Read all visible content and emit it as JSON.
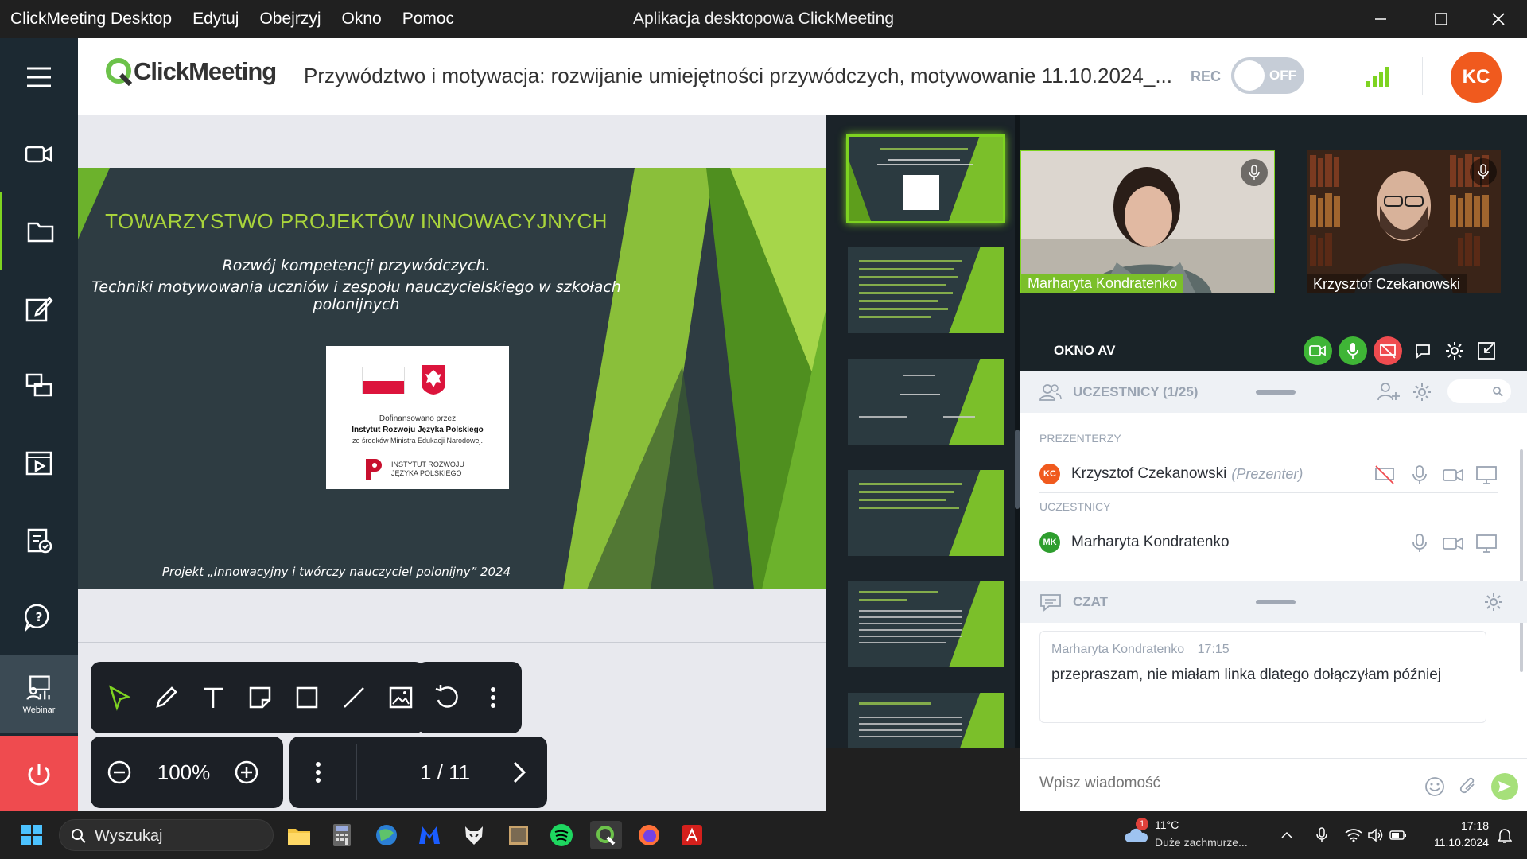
{
  "window": {
    "menu": [
      "ClickMeeting Desktop",
      "Edytuj",
      "Obejrzyj",
      "Okno",
      "Pomoc"
    ],
    "title": "Aplikacja desktopowa ClickMeeting"
  },
  "header": {
    "logo": "ClickMeeting",
    "meeting_title": "Przywództwo i motywacja: rozwijanie umiejętności przywódczych, motywowanie 11.10.2024_...",
    "rec_label": "REC",
    "rec_state": "OFF",
    "user_initials": "KC"
  },
  "sidebar": {
    "items": [
      "menu",
      "video",
      "files",
      "edit",
      "screen-share",
      "media",
      "survey",
      "qa",
      "webinar"
    ],
    "webinar_label": "Webinar"
  },
  "slide": {
    "title": "TOWARZYSTWO PROJEKTÓW INNOWACYJNYCH",
    "subtitle_1": "Rozwój kompetencji przywódczych.",
    "subtitle_2": "Techniki motywowania uczniów i zespołu nauczycielskiego w szkołach polonijnych",
    "card_line_1": "Dofinansowano przez",
    "card_line_2": "Instytut Rozwoju Języka Polskiego",
    "card_line_3": "ze środków Ministra Edukacji Narodowej.",
    "card_logo_1": "INSTYTUT ROZWOJU",
    "card_logo_2": "JĘZYKA POLSKIEGO",
    "footer": "Projekt „Innowacyjny i twórczy nauczyciel polonijny” 2024"
  },
  "toolbar": {
    "zoom": "100%",
    "page": "1 / 11"
  },
  "videos": [
    {
      "name": "Marharyta Kondratenko"
    },
    {
      "name": "Krzysztof Czekanowski"
    }
  ],
  "av_window": {
    "label": "OKNO AV"
  },
  "participants": {
    "header": "UCZESTNICY (1/25)",
    "presenters_label": "PREZENTERZY",
    "attendees_label": "UCZESTNICY",
    "presenter": {
      "initials": "KC",
      "name": "Krzysztof Czekanowski",
      "role": "(Prezenter)"
    },
    "attendee": {
      "initials": "MK",
      "name": "Marharyta Kondratenko"
    }
  },
  "chat": {
    "header": "CZAT",
    "message": {
      "author": "Marharyta Kondratenko",
      "time": "17:15",
      "text": "przepraszam, nie miałam linka dlatego dołączyłam później"
    },
    "input_placeholder": "Wpisz wiadomość"
  },
  "taskbar": {
    "search": "Wyszukaj",
    "weather_temp": "11°C",
    "weather_desc": "Duże zachmurze...",
    "weather_badge": "1",
    "time": "17:18",
    "date": "11.10.2024"
  },
  "colors": {
    "accent_green": "#7ed321",
    "brand_orange": "#f05a1e",
    "sidebar_bg": "#1c2932",
    "power_red": "#ef4b4f"
  }
}
